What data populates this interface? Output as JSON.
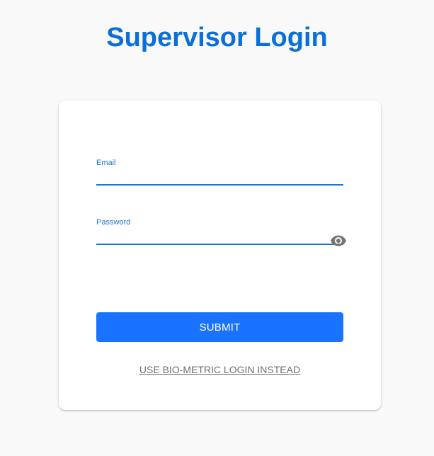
{
  "header": {
    "title": "Supervisor Login"
  },
  "form": {
    "email": {
      "label": "Email",
      "value": ""
    },
    "password": {
      "label": "Password",
      "value": "",
      "toggle_icon": "eye-icon"
    },
    "submit_label": "SUBMIT",
    "biometric_link_label": "USE BIO-METRIC LOGIN INSTEAD"
  },
  "colors": {
    "title": "#0a6fd6",
    "accent": "#1976d2",
    "button": "#1a73ff",
    "background": "#f9f9f9",
    "link": "#6f6f6f"
  }
}
